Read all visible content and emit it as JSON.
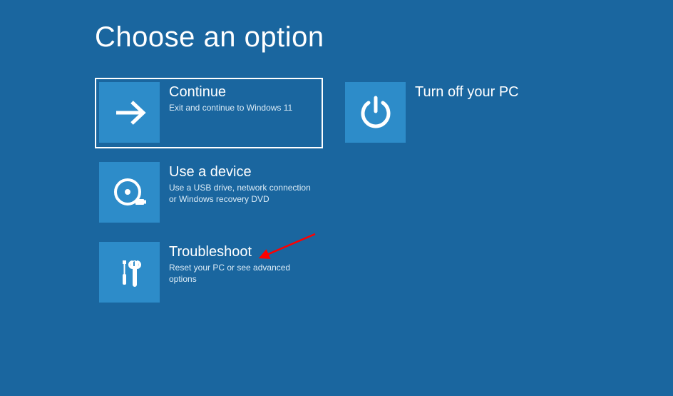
{
  "page": {
    "title": "Choose an option"
  },
  "options": {
    "continue": {
      "title": "Continue",
      "desc": "Exit and continue to Windows 11",
      "icon": "arrow-right-icon",
      "selected": true
    },
    "turnoff": {
      "title": "Turn off your PC",
      "desc": "",
      "icon": "power-icon"
    },
    "usedevice": {
      "title": "Use a device",
      "desc": "Use a USB drive, network connection or Windows recovery DVD",
      "icon": "disc-usb-icon"
    },
    "troubleshoot": {
      "title": "Troubleshoot",
      "desc": "Reset your PC or see advanced options",
      "icon": "tools-icon"
    }
  },
  "annotation": {
    "arrow_color": "#ff0000"
  },
  "colors": {
    "background": "#1a669f",
    "tile": "#2d8cc9",
    "text": "#ffffff",
    "desc": "#dcecf7"
  }
}
